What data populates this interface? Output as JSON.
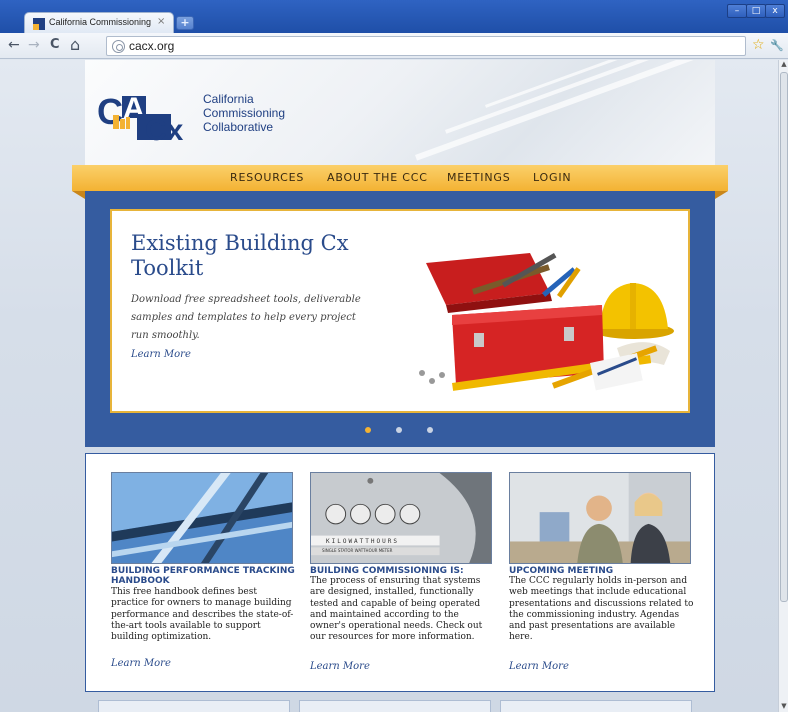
{
  "browser": {
    "tab_title": "California Commissioning Collal",
    "tab_close": "×",
    "new_tab": "+",
    "url": "cacx.org",
    "window_buttons": [
      "–",
      "□",
      "x"
    ],
    "nav": {
      "back": "←",
      "forward": "→",
      "reload": "C",
      "home": "⌂",
      "star": "☆",
      "wrench": "🔧"
    },
    "scroll_up": "▲",
    "scroll_down": "▼"
  },
  "site": {
    "org_name_lines": [
      "California",
      "Commissioning",
      "Collaborative"
    ],
    "logo": {
      "letters": "CA Cx",
      "colors": {
        "blue": "#1f3f82",
        "gold": "#f3b233"
      }
    },
    "nav": [
      "RESOURCES",
      "ABOUT THE CCC",
      "MEETINGS",
      "LOGIN"
    ],
    "hero": {
      "title": "Existing Building Cx Toolkit",
      "description": "Download free spreadsheet tools, deliverable samples and templates to help every project run smoothly.",
      "link": "Learn More",
      "image": "toolbox-hardhat-photo",
      "slides": 3,
      "active_slide": 1
    },
    "features": [
      {
        "title": "BUILDING PERFORMANCE TRACKING HANDBOOK",
        "body": "This free handbook defines best practice for owners to manage building performance and describes the state-of-the-art tools available to support building optimization.",
        "link": "Learn More",
        "image": "glass-roof-photo"
      },
      {
        "title": "BUILDING COMMISSIONING IS:",
        "body": "The process of ensuring that systems are designed, installed, functionally tested and capable of being operated and maintained according to the owner's operational needs. Check out our resources for more information.",
        "link": "Learn More",
        "image": "kilowatt-meter-photo",
        "image_text": [
          "KILOWATTHOURS",
          "SINGLE STATOR WATTHOUR METER"
        ]
      },
      {
        "title": "UPCOMING MEETING",
        "body": "The CCC regularly holds in-person and web meetings that include educational presentations and discussions related to the commissioning industry. Agendas and past presentations are available here.",
        "link": "Learn More",
        "image": "meeting-people-photo"
      }
    ],
    "colors": {
      "primary": "#355ca0",
      "accent": "#f3b233",
      "link": "#2a4b8b"
    }
  }
}
